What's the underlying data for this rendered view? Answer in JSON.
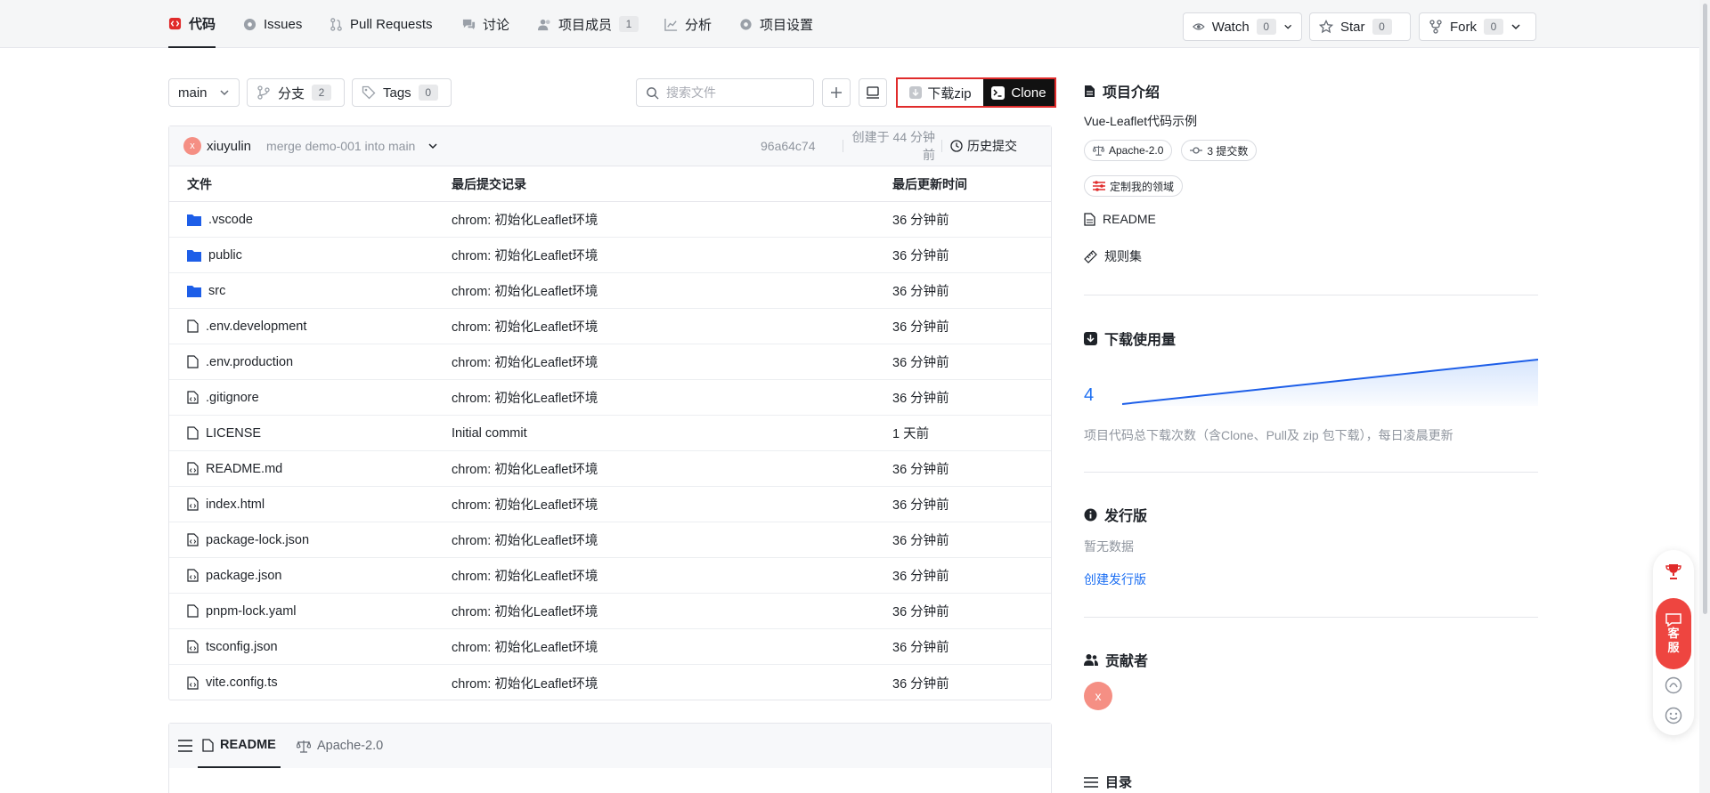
{
  "nav": {
    "tabs": [
      {
        "label": "代码"
      },
      {
        "label": "Issues"
      },
      {
        "label": "Pull Requests"
      },
      {
        "label": "讨论"
      },
      {
        "label": "项目成员",
        "count": "1"
      },
      {
        "label": "分析"
      },
      {
        "label": "项目设置"
      }
    ],
    "watch": {
      "label": "Watch",
      "count": "0"
    },
    "star": {
      "label": "Star",
      "count": "0"
    },
    "fork": {
      "label": "Fork",
      "count": "0"
    }
  },
  "toolbar": {
    "branch": "main",
    "branches": {
      "label": "分支",
      "count": "2"
    },
    "tags": {
      "label": "Tags",
      "count": "0"
    },
    "search_placeholder": "搜索文件",
    "download_zip": "下载zip",
    "clone": "Clone"
  },
  "commit": {
    "avatar": "x",
    "author": "xiuyulin",
    "message": "merge demo-001 into main",
    "hash": "96a64c74",
    "created": "创建于 44 分钟前",
    "history": "历史提交"
  },
  "table": {
    "headers": [
      "文件",
      "最后提交记录",
      "最后更新时间"
    ],
    "rows": [
      {
        "name": ".vscode",
        "type": "folder",
        "commit": "chrom: 初始化Leaflet环境",
        "time": "36 分钟前"
      },
      {
        "name": "public",
        "type": "folder",
        "commit": "chrom: 初始化Leaflet环境",
        "time": "36 分钟前"
      },
      {
        "name": "src",
        "type": "folder",
        "commit": "chrom: 初始化Leaflet环境",
        "time": "36 分钟前"
      },
      {
        "name": ".env.development",
        "type": "file",
        "commit": "chrom: 初始化Leaflet环境",
        "time": "36 分钟前"
      },
      {
        "name": ".env.production",
        "type": "file",
        "commit": "chrom: 初始化Leaflet环境",
        "time": "36 分钟前"
      },
      {
        "name": ".gitignore",
        "type": "code",
        "commit": "chrom: 初始化Leaflet环境",
        "time": "36 分钟前"
      },
      {
        "name": "LICENSE",
        "type": "file",
        "commit": "Initial commit",
        "time": "1 天前"
      },
      {
        "name": "README.md",
        "type": "code",
        "commit": "chrom: 初始化Leaflet环境",
        "time": "36 分钟前"
      },
      {
        "name": "index.html",
        "type": "code",
        "commit": "chrom: 初始化Leaflet环境",
        "time": "36 分钟前"
      },
      {
        "name": "package-lock.json",
        "type": "code",
        "commit": "chrom: 初始化Leaflet环境",
        "time": "36 分钟前"
      },
      {
        "name": "package.json",
        "type": "code",
        "commit": "chrom: 初始化Leaflet环境",
        "time": "36 分钟前"
      },
      {
        "name": "pnpm-lock.yaml",
        "type": "file",
        "commit": "chrom: 初始化Leaflet环境",
        "time": "36 分钟前"
      },
      {
        "name": "tsconfig.json",
        "type": "code",
        "commit": "chrom: 初始化Leaflet环境",
        "time": "36 分钟前"
      },
      {
        "name": "vite.config.ts",
        "type": "code",
        "commit": "chrom: 初始化Leaflet环境",
        "time": "36 分钟前"
      }
    ]
  },
  "readme": {
    "tab_readme": "README",
    "tab_license": "Apache-2.0"
  },
  "sidebar": {
    "intro_title": "项目介绍",
    "description": "Vue-Leaflet代码示例",
    "license": "Apache-2.0",
    "commits": "3 提交数",
    "customize": "定制我的领域",
    "readme": "README",
    "rules": "规则集",
    "downloads_title": "下载使用量",
    "downloads_count": "4",
    "downloads_note": "项目代码总下载次数（含Clone、Pull及 zip 包下载），每日凌晨更新",
    "release_title": "发行版",
    "release_empty": "暂无数据",
    "release_create": "创建发行版",
    "contributors_title": "贡献者",
    "contributor_avatar": "x",
    "toc_title": "目录"
  },
  "float": {
    "service_line1": "客",
    "service_line2": "服"
  },
  "colors": {
    "accent": "#1d6ff2",
    "highlight": "#e02b2b",
    "folder": "#1d5ee8",
    "avatar": "#f58f84",
    "service": "#ee4540"
  }
}
